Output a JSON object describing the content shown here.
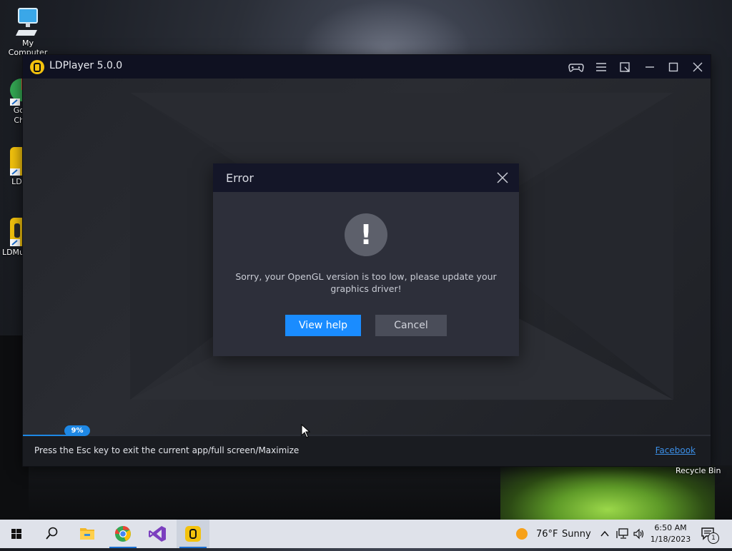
{
  "desktop": {
    "icons": [
      {
        "label": "My Computer",
        "icon": "computer-icon"
      },
      {
        "label": "Go\nCh",
        "icon": "chrome-icon"
      },
      {
        "label": "LDI",
        "icon": "ldplayer-icon"
      },
      {
        "label": "LDMu",
        "icon": "ldmultiplayer-icon"
      }
    ],
    "recycle_bin": "Recycle Bin"
  },
  "window": {
    "title": "LDPlayer 5.0.0",
    "controls": [
      "gamepad-icon",
      "menu-icon",
      "resize-icon",
      "minimize-icon",
      "maximize-icon",
      "close-icon"
    ],
    "progress": {
      "percent": 9,
      "label": "9%"
    },
    "footer_hint": "Press the Esc key to exit the current app/full screen/Maximize",
    "footer_link": "Facebook"
  },
  "dialog": {
    "title": "Error",
    "icon": "exclamation-icon",
    "mark": "!",
    "message": "Sorry, your OpenGL version is too low, please update your graphics driver!",
    "primary_button": "View help",
    "secondary_button": "Cancel"
  },
  "taskbar": {
    "apps": [
      "start-icon",
      "search-icon",
      "file-explorer-icon",
      "chrome-icon",
      "visual-studio-icon",
      "ldplayer-icon"
    ],
    "weather": {
      "temp": "76°F",
      "condition": "Sunny"
    },
    "time": "6:50 AM",
    "date": "1/18/2023",
    "notification_count": "1"
  },
  "colors": {
    "accent": "#1a8cff",
    "titlebar": "#0f1121",
    "dialog_bg": "#2d2f3a"
  }
}
